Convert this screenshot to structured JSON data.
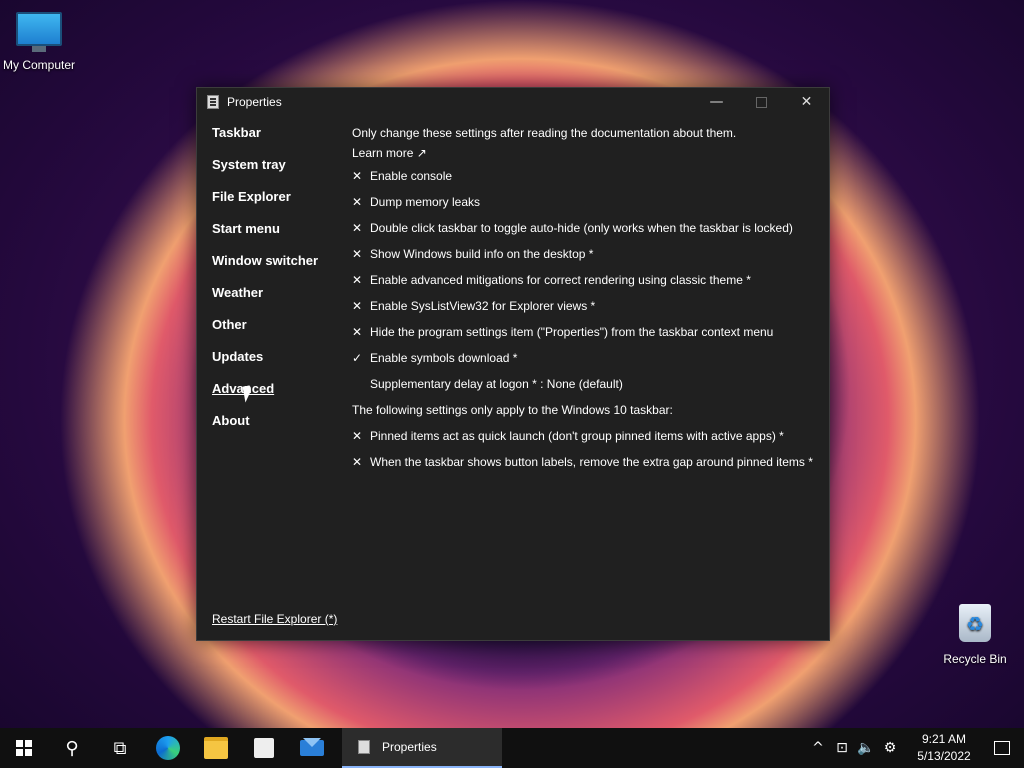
{
  "desktop": {
    "icons": [
      {
        "label": "My Computer",
        "icon": "computer-icon"
      },
      {
        "label": "Recycle Bin",
        "icon": "recycle-bin-icon"
      }
    ]
  },
  "window": {
    "title": "Properties",
    "controls": {
      "minimize": "—",
      "maximize": "",
      "close": "✕"
    }
  },
  "sidebar": {
    "items": [
      {
        "label": "Taskbar"
      },
      {
        "label": "System tray"
      },
      {
        "label": "File Explorer"
      },
      {
        "label": "Start menu"
      },
      {
        "label": "Window switcher"
      },
      {
        "label": "Weather"
      },
      {
        "label": "Other"
      },
      {
        "label": "Updates"
      },
      {
        "label": "Advanced",
        "active": true
      },
      {
        "label": "About"
      }
    ],
    "restart_label": "Restart File Explorer (*)"
  },
  "content": {
    "intro": "Only change these settings after reading the documentation about them.",
    "learn_more": "Learn more ↗",
    "options": [
      {
        "mark": "✕",
        "label": "Enable console"
      },
      {
        "mark": "✕",
        "label": "Dump memory leaks"
      },
      {
        "mark": "✕",
        "label": "Double click taskbar to toggle auto-hide (only works when the taskbar is locked)"
      },
      {
        "mark": "✕",
        "label": "Show Windows build info on the desktop *"
      },
      {
        "mark": "✕",
        "label": "Enable advanced mitigations for correct rendering using classic theme *"
      },
      {
        "mark": "✕",
        "label": "Enable SysListView32 for Explorer views *"
      },
      {
        "mark": "✕",
        "label": "Hide the program settings item (\"Properties\") from the taskbar context menu"
      },
      {
        "mark": "✓",
        "label": "Enable symbols download *"
      },
      {
        "mark": "",
        "label": "Supplementary delay at logon * : None (default)"
      }
    ],
    "win10_heading": "The following settings only apply to the Windows 10 taskbar:",
    "win10_options": [
      {
        "mark": "✕",
        "label": "Pinned items act as quick launch (don't group pinned items with active apps) *"
      },
      {
        "mark": "✕",
        "label": "When the taskbar shows button labels, remove the extra gap around pinned items *"
      }
    ]
  },
  "taskbar": {
    "pinned": [
      "start-icon",
      "search-icon",
      "task-view-icon",
      "edge-icon",
      "file-explorer-icon",
      "store-icon",
      "mail-icon"
    ],
    "active_task": "Properties",
    "tray": {
      "chevron": "^",
      "time": "9:21 AM",
      "date": "5/13/2022"
    }
  },
  "colors": {
    "window_bg": "#202020",
    "taskbar_bg": "#101010",
    "accent": "#8ab4f8"
  }
}
